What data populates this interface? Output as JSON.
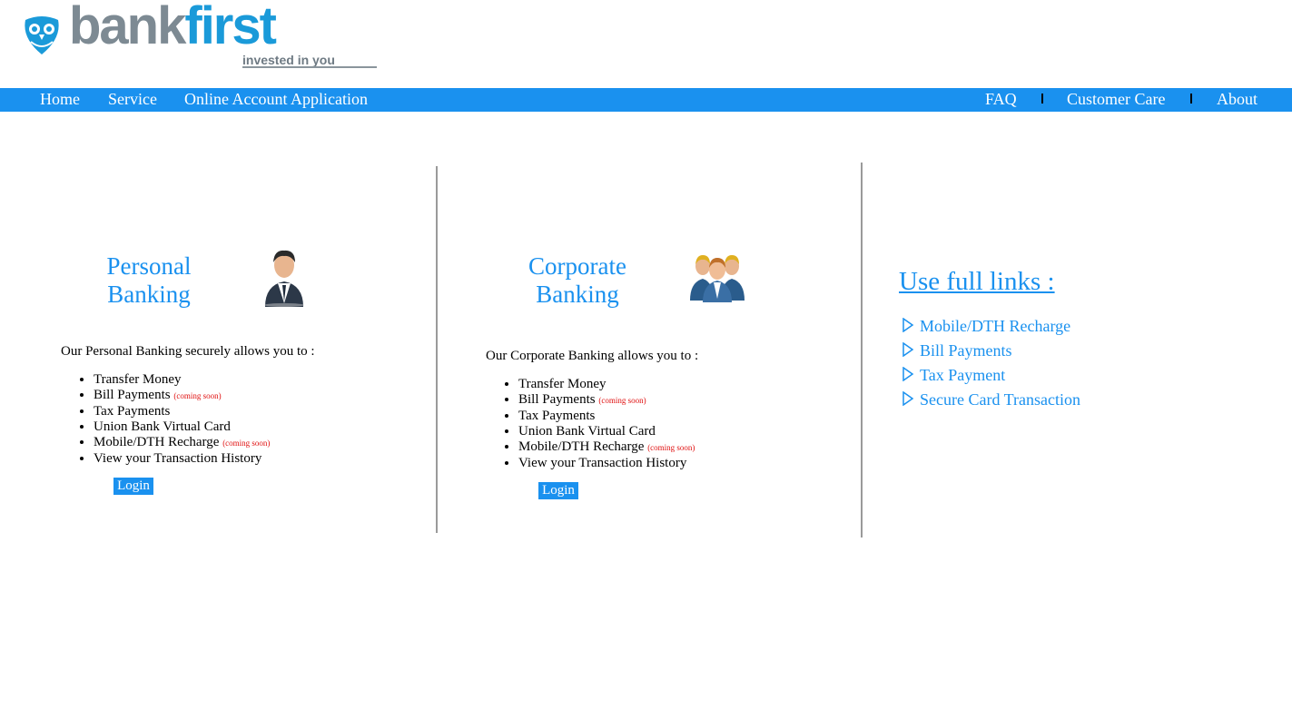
{
  "brand": {
    "name_part1": "bank",
    "name_part2": "first",
    "tagline": "invested in you"
  },
  "nav": {
    "left": [
      "Home",
      "Service",
      "Online Account Application"
    ],
    "right": [
      "FAQ",
      "Customer Care",
      "About"
    ]
  },
  "personal": {
    "title_line1": "Personal",
    "title_line2": "Banking",
    "intro": "Our Personal Banking securely allows you to :",
    "features": [
      {
        "label": "Transfer Money",
        "note": ""
      },
      {
        "label": "Bill Payments",
        "note": "(coming soon)"
      },
      {
        "label": "Tax Payments",
        "note": ""
      },
      {
        "label": "Union Bank Virtual Card",
        "note": ""
      },
      {
        "label": "Mobile/DTH Recharge",
        "note": "(coming soon)"
      },
      {
        "label": "View your Transaction History",
        "note": ""
      }
    ],
    "login_label": "Login"
  },
  "corporate": {
    "title_line1": "Corporate",
    "title_line2": "Banking",
    "intro": "Our Corporate Banking allows you to :",
    "features": [
      {
        "label": "Transfer Money",
        "note": ""
      },
      {
        "label": "Bill Payments",
        "note": "(coming soon)"
      },
      {
        "label": "Tax Payments",
        "note": ""
      },
      {
        "label": "Union Bank Virtual Card",
        "note": ""
      },
      {
        "label": "Mobile/DTH Recharge",
        "note": "(coming soon)"
      },
      {
        "label": "View your Transaction History",
        "note": ""
      }
    ],
    "login_label": "Login"
  },
  "useful_links": {
    "title": "Use full links :",
    "items": [
      "Mobile/DTH Recharge",
      "Bill Payments",
      "Tax Payment",
      "Secure Card Transaction"
    ]
  },
  "colors": {
    "accent": "#1a91ef",
    "brand_gray": "#7d8a93",
    "brand_blue": "#1a9ad9",
    "coming_soon": "#e01010"
  },
  "icons": [
    "owl-logo-icon",
    "businessman-icon",
    "business-group-icon",
    "triangle-right-icon"
  ]
}
